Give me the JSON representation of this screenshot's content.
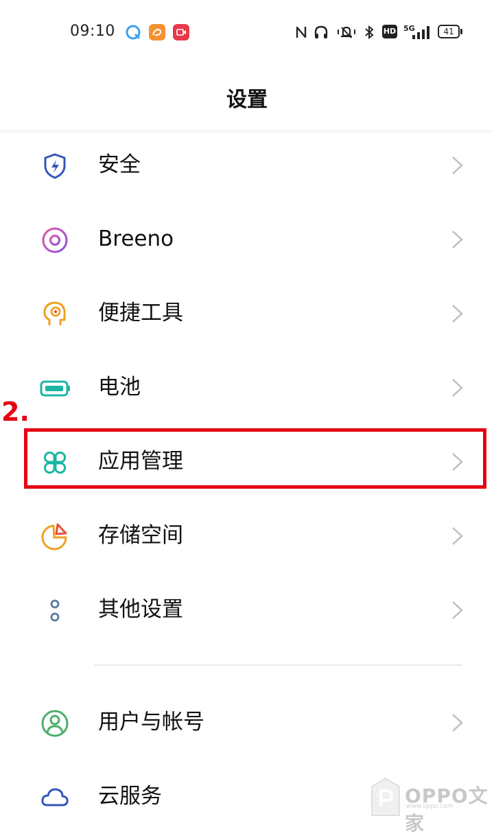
{
  "status_bar": {
    "time": "09:10",
    "battery": "41",
    "network": "5G",
    "hd": "HD",
    "icons": [
      "browser-icon",
      "uc-browser-icon",
      "screen-record-icon",
      "nfc-icon",
      "headphones-icon",
      "vibrate-icon",
      "bluetooth-icon",
      "hd-icon",
      "signal-icon",
      "battery-icon"
    ]
  },
  "header": {
    "title": "设置"
  },
  "annotation": {
    "step": "2.",
    "color": "#e60012"
  },
  "settings": {
    "items": [
      {
        "label": "安全",
        "icon": "shield-bolt-icon",
        "color": "#3556b8"
      },
      {
        "label": "Breeno",
        "icon": "breeno-ring-icon",
        "color": "#c04bd6"
      },
      {
        "label": "便捷工具",
        "icon": "head-gear-icon",
        "color": "#f0a020"
      },
      {
        "label": "电池",
        "icon": "battery-outline-icon",
        "color": "#1bb6a2"
      },
      {
        "label": "应用管理",
        "icon": "app-grid-icon",
        "color": "#1bb6a2"
      },
      {
        "label": "存储空间",
        "icon": "pie-chart-icon",
        "color": "#f0a020"
      },
      {
        "label": "其他设置",
        "icon": "dots-icon",
        "color": "#5a7aa0"
      },
      {
        "label": "用户与帐号",
        "icon": "user-circle-icon",
        "color": "#4caf6a"
      },
      {
        "label": "云服务",
        "icon": "cloud-icon",
        "color": "#3556b8"
      }
    ]
  },
  "watermark": {
    "text": "OPPO文家",
    "sub": "www.oppo.com"
  }
}
